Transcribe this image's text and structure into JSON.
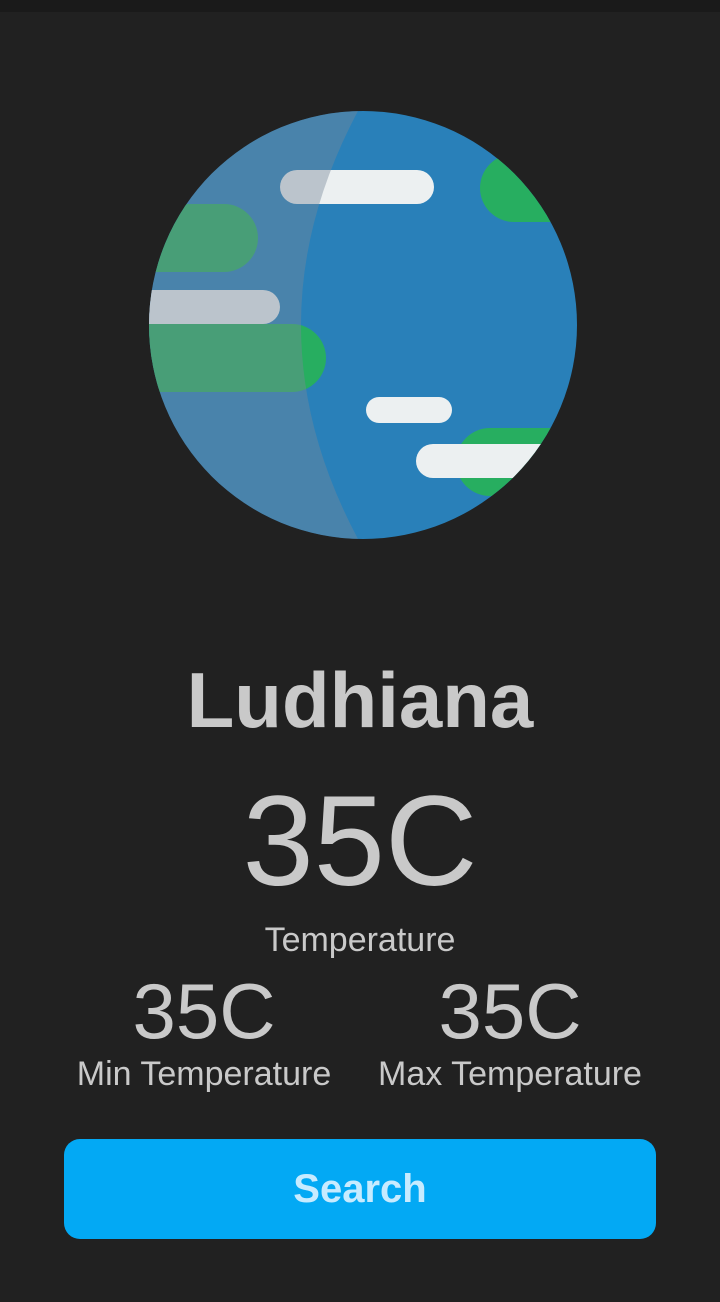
{
  "weather": {
    "city": "Ludhiana",
    "temperature": "35C",
    "temperature_label": "Temperature",
    "min_temperature": "35C",
    "min_label": "Min Temperature",
    "max_temperature": "35C",
    "max_label": "Max Temperature"
  },
  "actions": {
    "search_label": "Search"
  },
  "illustration": {
    "icon": "globe-icon",
    "colors": {
      "ocean": "#2980b9",
      "land": "#27ae60",
      "cloud": "#ecf0f1",
      "background": "#212121",
      "button": "#03a9f4"
    }
  }
}
